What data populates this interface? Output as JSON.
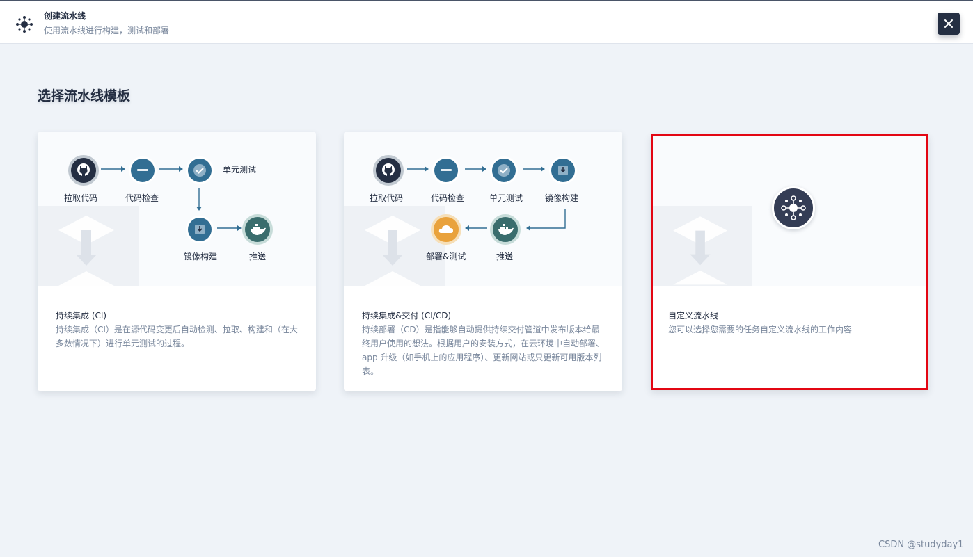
{
  "header": {
    "title": "创建流水线",
    "subtitle": "使用流水线进行构建，测试和部署"
  },
  "section_title": "选择流水线模板",
  "cards": [
    {
      "name": "持续集成 (CI)",
      "description": "持续集成（CI）是在源代码变更后自动检测、拉取、构建和（在大多数情况下）进行单元测试的过程。",
      "stages": [
        "拉取代码",
        "代码检查",
        "单元测试",
        "镜像构建",
        "推送"
      ]
    },
    {
      "name": "持续集成&交付 (CI/CD)",
      "description": "持续部署（CD）是指能够自动提供持续交付管道中发布版本给最终用户使用的想法。根据用户的安装方式，在云环境中自动部署、app 升级（如手机上的应用程序）、更新网站或只更新可用版本列表。",
      "stages": [
        "拉取代码",
        "代码检查",
        "单元测试",
        "镜像构建",
        "推送",
        "部署&测试"
      ]
    },
    {
      "name": "自定义流水线",
      "description": "您可以选择您需要的任务自定义流水线的工作内容"
    }
  ],
  "watermark": "CSDN @studyday1",
  "colors": {
    "dark": "#242e42",
    "teal": "#326e93",
    "muted": "#79879c",
    "selection": "#e30613",
    "deploy": "#e9a23c"
  },
  "icons": [
    "pipeline-icon",
    "close-icon",
    "github-icon",
    "sonarqube-icon",
    "check-icon",
    "image-build-icon",
    "docker-icon",
    "cloud-deploy-icon",
    "arrow-icon"
  ]
}
